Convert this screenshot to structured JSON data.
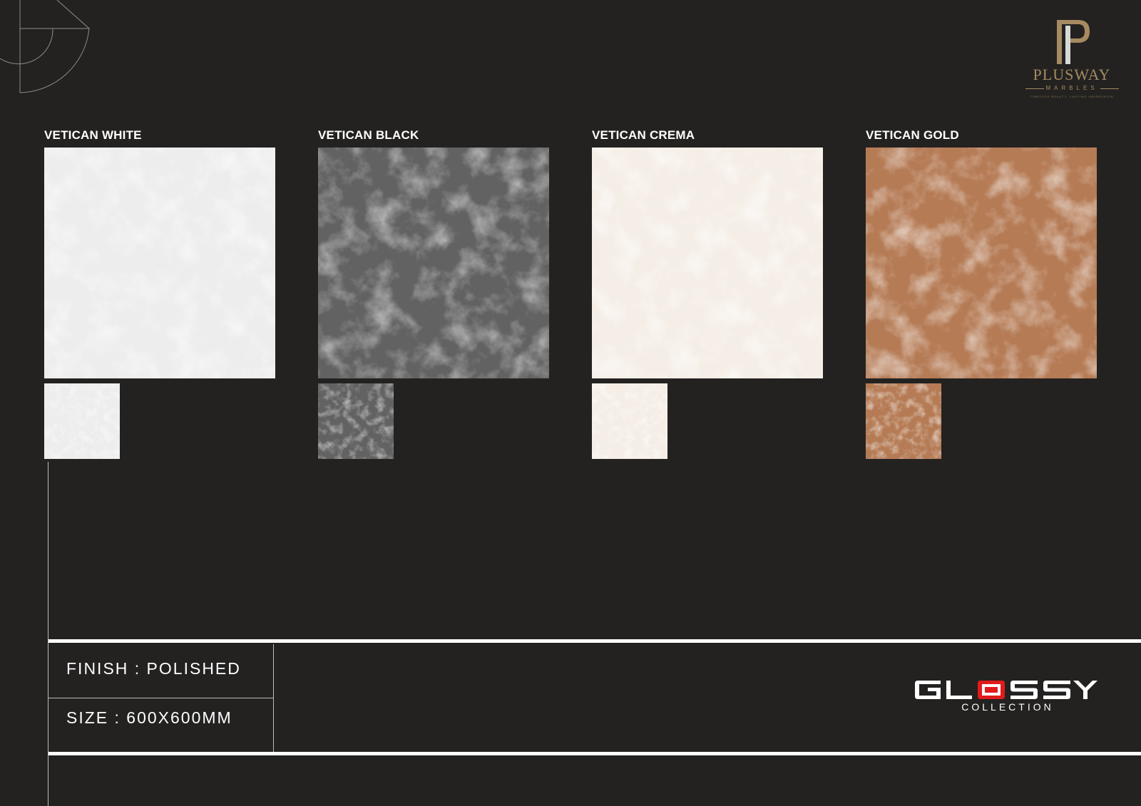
{
  "brand": {
    "name": "PLUSWAY",
    "subtitle": "MARBLES",
    "tagline": "TIMELESS BEAUTY, LASTING IMPRESSION",
    "gold_color": "#a58a62"
  },
  "tiles": [
    {
      "title": "VETICAN WHITE",
      "base_color": "#ededed",
      "vein_color": "#d9d9d9"
    },
    {
      "title": "VETICAN BLACK",
      "base_color": "#626262",
      "vein_color": "#9a9a9a"
    },
    {
      "title": "VETICAN CREMA",
      "base_color": "#f5eee6",
      "vein_color": "#ead8c4"
    },
    {
      "title": "VETICAN GOLD",
      "base_color": "#b57b55",
      "vein_color": "#d4a886"
    }
  ],
  "specs": {
    "finish": "FINISH : POLISHED",
    "size": "SIZE : 600X600MM"
  },
  "collection": {
    "name": "GLOSSY",
    "subtitle": "COLLECTION",
    "accent_color": "#e11b1b"
  }
}
